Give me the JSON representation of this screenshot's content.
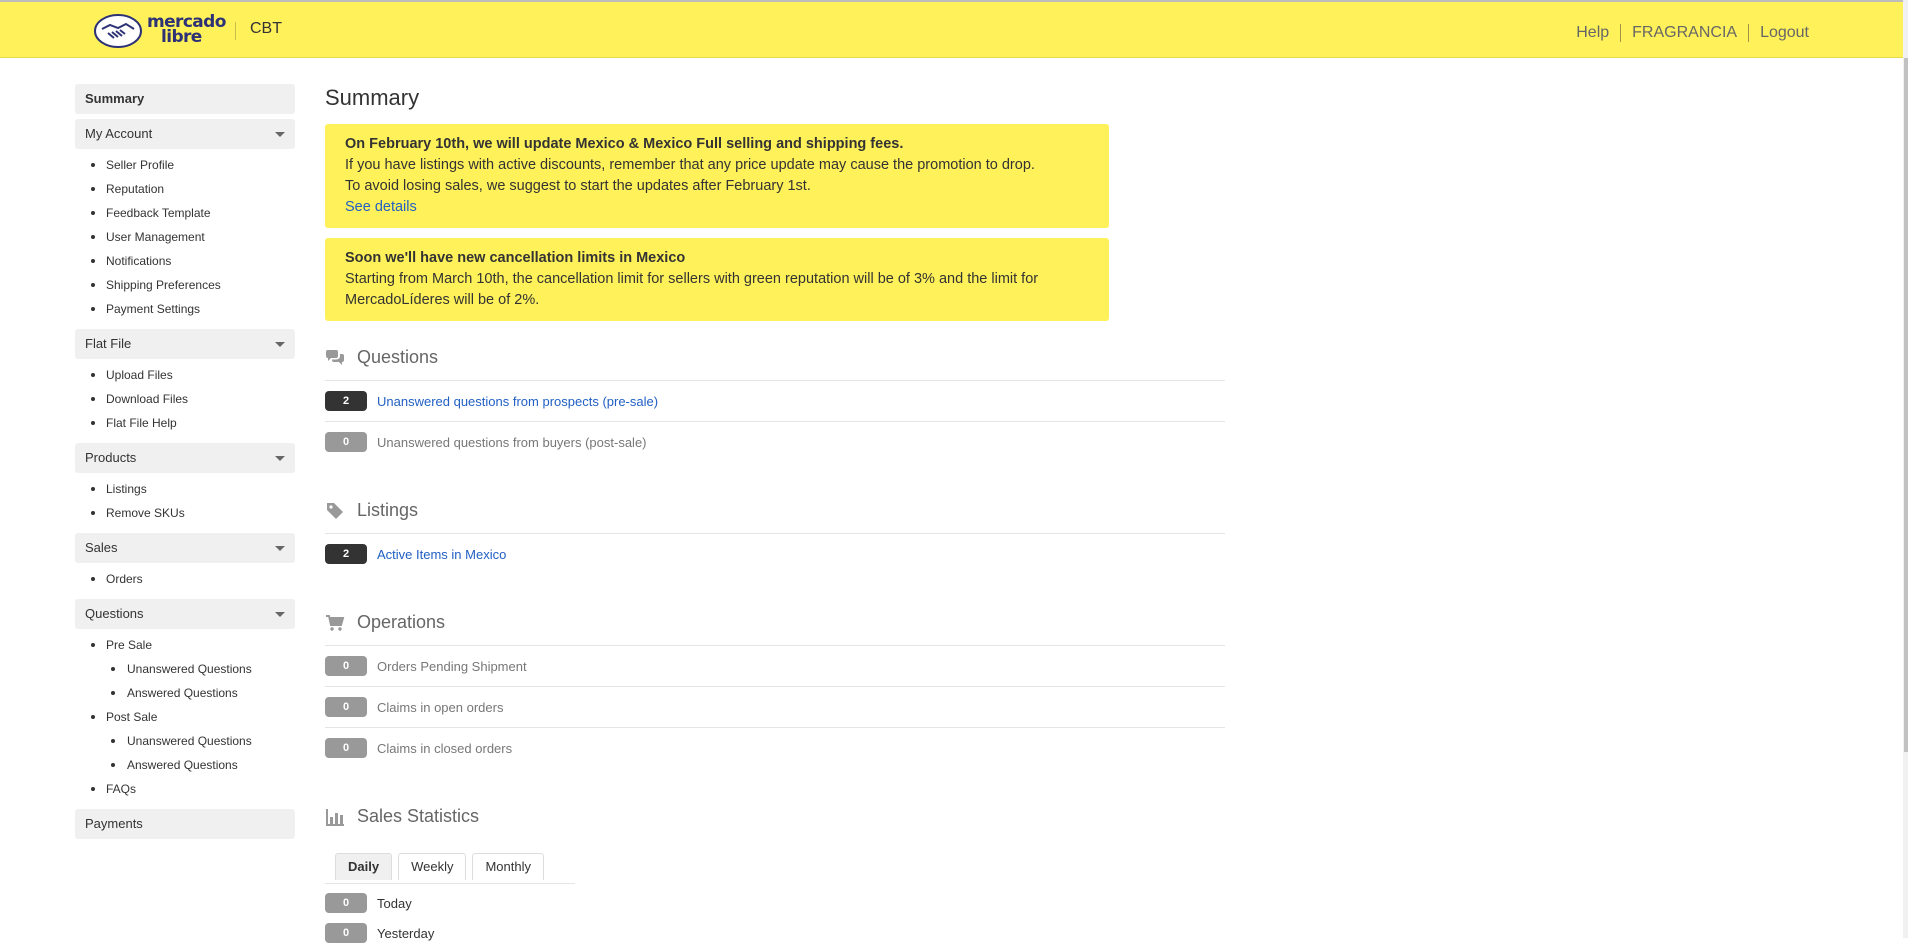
{
  "header": {
    "logo_line1": "mercado",
    "logo_line2": "libre",
    "site": "CBT",
    "nav": {
      "help": "Help",
      "user": "FRAGRANCIA",
      "logout": "Logout"
    }
  },
  "sidebar": {
    "summary": "Summary",
    "my_account": {
      "label": "My Account",
      "items": [
        "Seller Profile",
        "Reputation",
        "Feedback Template",
        "User Management",
        "Notifications",
        "Shipping Preferences",
        "Payment Settings"
      ]
    },
    "flat_file": {
      "label": "Flat File",
      "items": [
        "Upload Files",
        "Download Files",
        "Flat File Help"
      ]
    },
    "products": {
      "label": "Products",
      "items": [
        "Listings",
        "Remove SKUs"
      ]
    },
    "sales": {
      "label": "Sales",
      "items": [
        "Orders"
      ]
    },
    "questions": {
      "label": "Questions",
      "pre_sale": "Pre Sale",
      "pre_unanswered": "Unanswered Questions",
      "pre_answered": "Answered Questions",
      "post_sale": "Post Sale",
      "post_unanswered": "Unanswered Questions",
      "post_answered": "Answered Questions",
      "faqs": "FAQs"
    },
    "payments": "Payments"
  },
  "main": {
    "title": "Summary",
    "notice1": {
      "title": "On February 10th, we will update Mexico & Mexico Full selling and shipping fees.",
      "line1": "If you have listings with active discounts, remember that any price update may cause the promotion to drop.",
      "line2": "To avoid losing sales, we suggest to start the updates after February 1st.",
      "link": "See details"
    },
    "notice2": {
      "title": "Soon we'll have new cancellation limits in Mexico",
      "text": "Starting from March 10th, the cancellation limit for sellers with green reputation will be of 3% and the limit for MercadoLíderes will be of 2%."
    },
    "questions": {
      "title": "Questions",
      "rows": [
        {
          "count": "2",
          "label": "Unanswered questions from prospects (pre-sale)"
        },
        {
          "count": "0",
          "label": "Unanswered questions from buyers (post-sale)"
        }
      ]
    },
    "listings": {
      "title": "Listings",
      "rows": [
        {
          "count": "2",
          "label": "Active Items in Mexico"
        }
      ]
    },
    "operations": {
      "title": "Operations",
      "rows": [
        {
          "count": "0",
          "label": "Orders Pending Shipment"
        },
        {
          "count": "0",
          "label": "Claims in open orders"
        },
        {
          "count": "0",
          "label": "Claims in closed orders"
        }
      ]
    },
    "sales_statistics": {
      "title": "Sales Statistics",
      "tabs": [
        "Daily",
        "Weekly",
        "Monthly"
      ],
      "rows": [
        {
          "count": "0",
          "label": "Today"
        },
        {
          "count": "0",
          "label": "Yesterday"
        }
      ]
    }
  },
  "colors": {
    "header_bg": "#fff159",
    "link": "#2260c4",
    "badge_dark": "#333333",
    "badge_muted": "#999999"
  },
  "icons": [
    "handshake-logo-icon",
    "chat-bubbles-icon",
    "tag-icon",
    "cart-icon",
    "bar-chart-icon",
    "caret-down-icon"
  ]
}
